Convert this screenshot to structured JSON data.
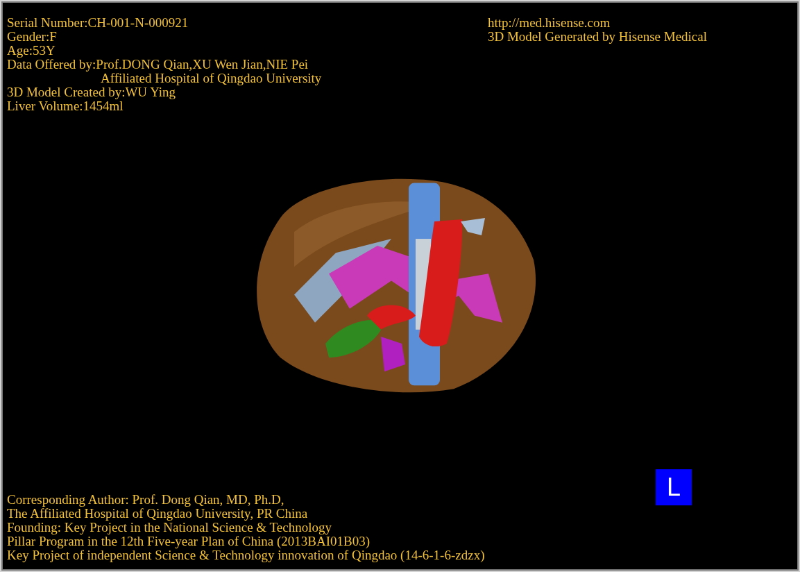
{
  "info_top_left": [
    {
      "text": "Serial Number:CH-001-N-000921",
      "kind": "line"
    },
    {
      "text": "Gender:F",
      "kind": "line"
    },
    {
      "text": "Age:53Y",
      "kind": "line"
    },
    {
      "text": "Data Offered by:Prof.DONG Qian,XU Wen Jian,NIE Pei",
      "kind": "line"
    },
    {
      "text": "Affiliated Hospital of Qingdao University",
      "kind": "continuation"
    },
    {
      "text": "3D Model Created by:WU Ying",
      "kind": "line"
    },
    {
      "text": "Liver Volume:1454ml",
      "kind": "line"
    }
  ],
  "info_top_right": [
    {
      "text": "http://med.hisense.com",
      "kind": "line"
    },
    {
      "text": "3D Model Generated by Hisense Medical",
      "kind": "line"
    }
  ],
  "footer": [
    {
      "text": "Corresponding Author: Prof. Dong Qian, MD, Ph.D,",
      "kind": "line"
    },
    {
      "text": "The Affiliated Hospital of Qingdao University, PR China",
      "kind": "line"
    },
    {
      "text": "Founding: Key Project in the National Science & Technology",
      "kind": "line"
    },
    {
      "text": "Pillar Program in the 12th Five-year Plan of China (2013BAI01B03)",
      "kind": "line"
    },
    {
      "text": "Key Project of independent Science & Technology innovation of Qingdao (14-6-1-6-zdzx)",
      "kind": "line"
    }
  ],
  "orientation_marker": "L"
}
